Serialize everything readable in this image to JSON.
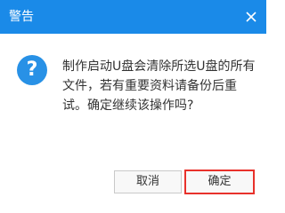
{
  "dialog": {
    "title": "警告",
    "close_icon": "close-icon",
    "icon": "question-icon",
    "icon_glyph": "?",
    "message": "制作启动U盘会清除所选U盘的所有文件，若有重要资料请备份后重试。确定继续该操作吗?",
    "cancel_label": "取消",
    "ok_label": "确定"
  },
  "colors": {
    "titlebar": "#1a8ae8",
    "icon": "#2891e6",
    "highlight_border": "#e8312b"
  }
}
